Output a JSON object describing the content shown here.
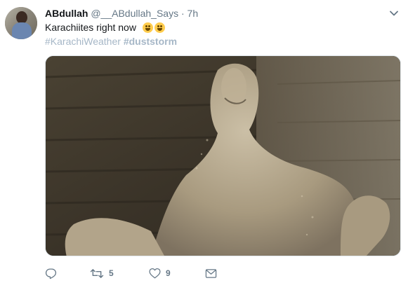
{
  "tweet": {
    "display_name": "ABdullah",
    "handle": "@__ABdullah_Says",
    "separator": "·",
    "time": "7h",
    "text": "Karachiites right now",
    "hashtags": [
      "#KarachiWeather",
      "#duststorm"
    ],
    "icons": {
      "caret": "chevron-down-icon",
      "reply": "reply-icon",
      "retweet": "retweet-icon",
      "like": "heart-icon",
      "message": "envelope-icon",
      "emoji1": "grinning-face-emoji",
      "emoji2": "tears-of-joy-emoji"
    },
    "actions": {
      "retweet_count": "5",
      "like_count": "9"
    },
    "colors": {
      "text": "#14171a",
      "secondary": "#657786",
      "hashtag": "#a6b7c7"
    }
  }
}
